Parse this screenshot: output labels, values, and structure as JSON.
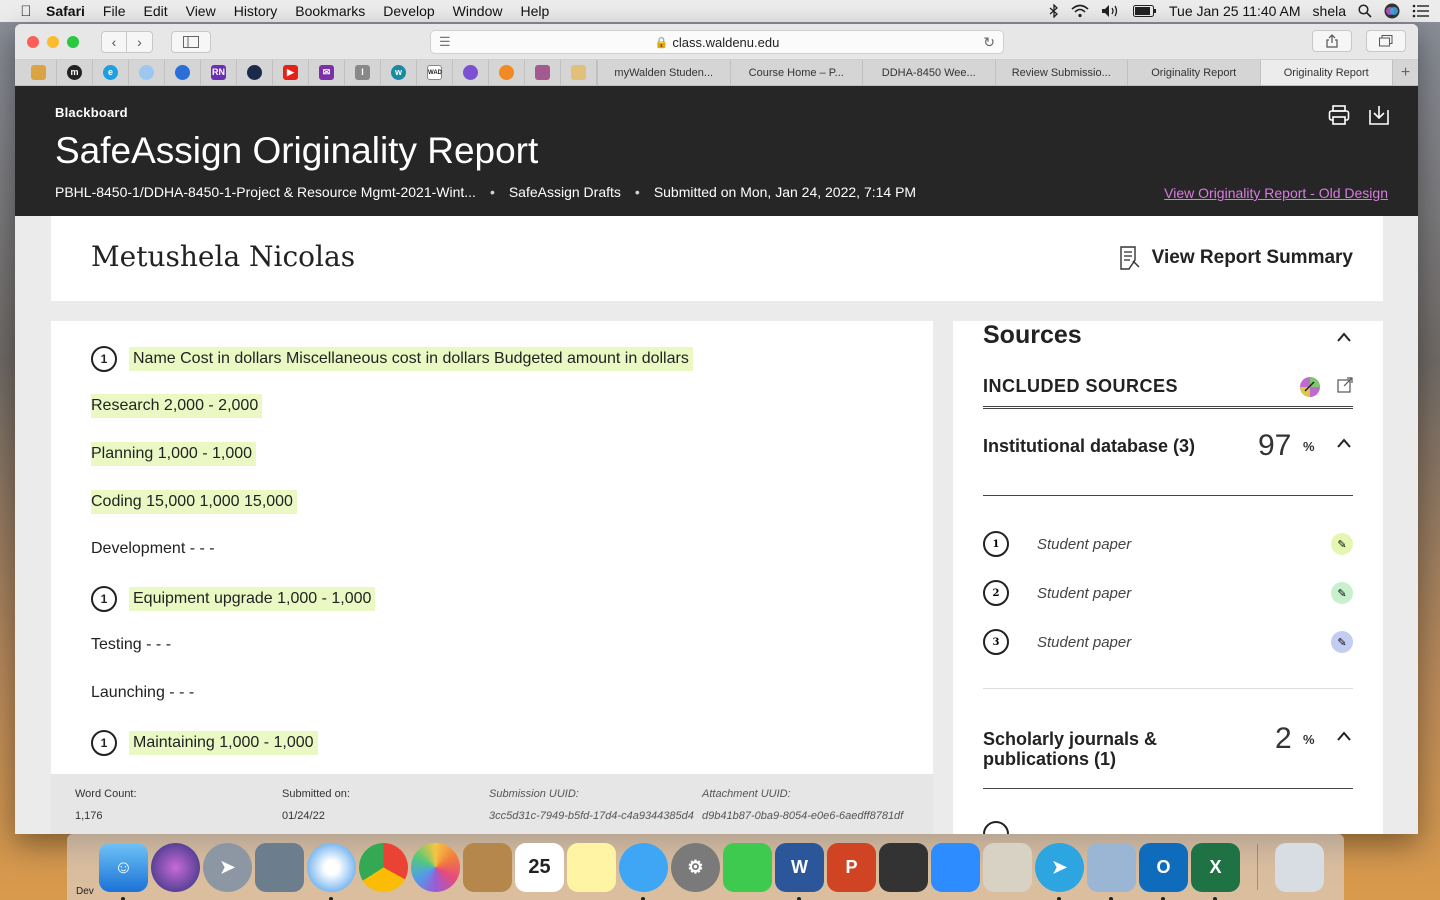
{
  "menubar": {
    "app": "Safari",
    "items": [
      "File",
      "Edit",
      "View",
      "History",
      "Bookmarks",
      "Develop",
      "Window",
      "Help"
    ],
    "clock": "Tue Jan 25  11:40 AM",
    "user": "shela"
  },
  "browser": {
    "url": "class.waldenu.edu",
    "tabs": [
      "myWalden Studen...",
      "Course Home – P...",
      "DDHA-8450 Wee...",
      "Review Submissio...",
      "Originality Report",
      "Originality Report"
    ],
    "active_tab_index": 5
  },
  "report": {
    "brand": "Blackboard",
    "title": "SafeAssign Originality Report",
    "course": "PBHL-8450-1/DDHA-8450-1-Project & Resource Mgmt-2021-Wint...",
    "assignment": "SafeAssign Drafts",
    "submitted": "Submitted on Mon, Jan 24, 2022, 7:14 PM",
    "old_design_link": "View Originality Report - Old Design",
    "student_name": "Metushela Nicolas",
    "summary_button": "View Report Summary"
  },
  "document": {
    "lines": [
      {
        "text": "Name Cost in dollars Miscellaneous cost in dollars Budgeted amount in dollars",
        "cite": "1",
        "highlight": true
      },
      {
        "text": "Research 2,000 - 2,000",
        "cite": "",
        "highlight": true
      },
      {
        "text": "Planning 1,000 - 1,000",
        "cite": "",
        "highlight": true
      },
      {
        "text": "Coding 15,000 1,000 15,000",
        "cite": "",
        "highlight": true
      },
      {
        "text": "Development - - -",
        "cite": "",
        "highlight": false
      },
      {
        "text": "Equipment upgrade 1,000 - 1,000",
        "cite": "1",
        "highlight": true
      },
      {
        "text": "Testing - - -",
        "cite": "",
        "highlight": false
      },
      {
        "text": "Launching - - -",
        "cite": "",
        "highlight": false
      },
      {
        "text": "Maintaining 1,000 - 1,000",
        "cite": "1",
        "highlight": true
      }
    ],
    "footer": {
      "word_count_label": "Word Count:",
      "word_count": "1,176",
      "submitted_label": "Submitted on:",
      "submitted_date": "01/24/22",
      "submission_uuid_label": "Submission UUID:",
      "submission_uuid": "3cc5d31c-7949-b5fd-17d4-c4a9344385d4",
      "attachment_uuid_label": "Attachment UUID:",
      "attachment_uuid": "d9b41b87-0ba9-8054-e0e6-6aedff8781df"
    }
  },
  "sources": {
    "title": "Sources",
    "included_label": "INCLUDED SOURCES",
    "groups": [
      {
        "name": "Institutional database (3)",
        "percent": "97",
        "percent_sign": "%",
        "items": [
          {
            "num": "1",
            "label": "Student paper",
            "color": "#e4f6b0"
          },
          {
            "num": "2",
            "label": "Student paper",
            "color": "#c8f0cc"
          },
          {
            "num": "3",
            "label": "Student paper",
            "color": "#c3cdf2"
          }
        ]
      },
      {
        "name": "Scholarly journals & publications (1)",
        "percent": "2",
        "percent_sign": "%",
        "items": []
      }
    ]
  },
  "dock": {
    "desktop_label": "Dev"
  },
  "colors": {
    "highlight": "#eaf8c4",
    "header_bg": "#262626",
    "link": "#d97ce0"
  }
}
